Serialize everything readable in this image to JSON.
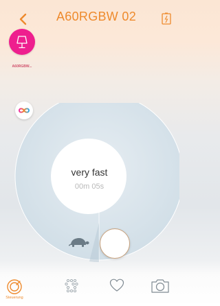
{
  "header": {
    "title": "A60RGBW 02",
    "back_icon": "chevron-left-icon",
    "right_icon": "battery-icon"
  },
  "lamp": {
    "label": "A60RGBW...",
    "icon": "lamp-icon",
    "color": "#ee1f8e"
  },
  "loop_icon": "infinity-icon",
  "speed": {
    "label": "very fast",
    "time": "00m 05s",
    "slow_icon": "turtle-icon"
  },
  "tabs": [
    {
      "label": "Steuerung",
      "icon": "control-dial-icon",
      "active": true
    },
    {
      "label": "",
      "icon": "dots-grid-icon",
      "active": false
    },
    {
      "label": "",
      "icon": "heart-icon",
      "active": false
    },
    {
      "label": "",
      "icon": "camera-icon",
      "active": false
    }
  ],
  "colors": {
    "accent": "#ee8a2c",
    "dial": "#d8e3ea",
    "lamp": "#ee1f8e"
  }
}
